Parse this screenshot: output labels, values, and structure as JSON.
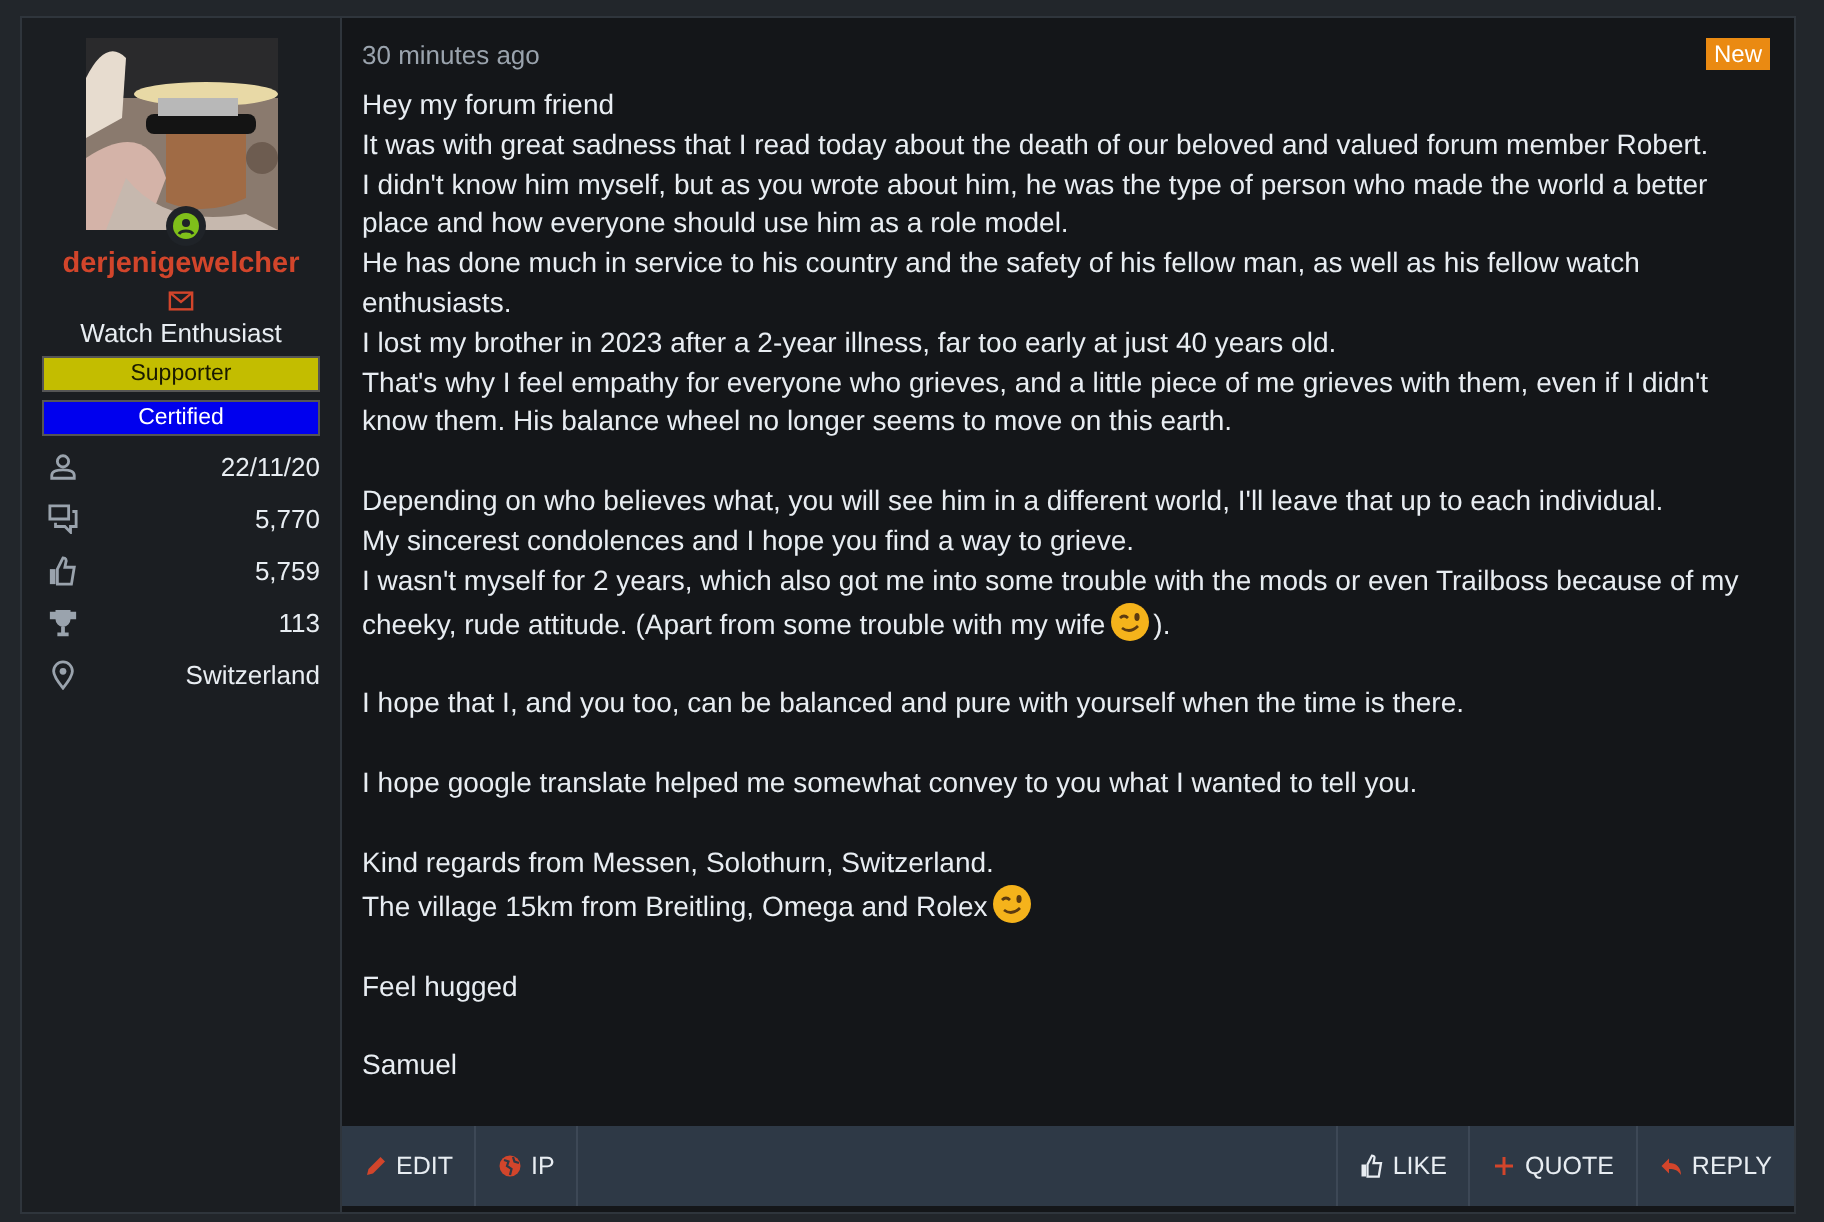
{
  "author": {
    "online": true,
    "username": "derjenigewelcher",
    "title": "Watch Enthusiast",
    "banners": [
      {
        "label": "Supporter",
        "color": "#c3bd00"
      },
      {
        "label": "Certified",
        "color": "#0000ee"
      }
    ],
    "stats": [
      {
        "kind": "joined",
        "value": "22/11/20"
      },
      {
        "kind": "messages",
        "value": "5,770"
      },
      {
        "kind": "reactions",
        "value": "5,759"
      },
      {
        "kind": "points",
        "value": "113"
      },
      {
        "kind": "location",
        "value": "Switzerland"
      }
    ]
  },
  "post": {
    "time": "30 minutes ago",
    "new_label": "New",
    "paragraphs": [
      [
        [
          {
            "kind": "text",
            "text": "Hey my forum friend"
          }
        ],
        [
          {
            "kind": "text",
            "text": "It was with great sadness that I read today about the death of our beloved and valued forum member Robert."
          }
        ],
        [
          {
            "kind": "text",
            "text": "I didn't know him myself, but as you wrote about him, he was the type of person who made the world a better place and how everyone should use him as a role model."
          }
        ],
        [
          {
            "kind": "text",
            "text": "He has done much in service to his country and the safety of his fellow man, as well as his fellow watch enthusiasts."
          }
        ],
        [
          {
            "kind": "text",
            "text": "I lost my brother in 2023 after a 2-year illness, far too early at just 40 years old."
          }
        ],
        [
          {
            "kind": "text",
            "text": "That's why I feel empathy for everyone who grieves, and a little piece of me grieves with them, even if I didn't know them. His balance wheel no longer seems to move on this earth."
          }
        ]
      ],
      [
        [
          {
            "kind": "text",
            "text": "Depending on who believes what, you will see him in a different world, I'll leave that up to each individual."
          }
        ],
        [
          {
            "kind": "text",
            "text": "My sincerest condolences and I hope you find a way to grieve."
          }
        ],
        [
          {
            "kind": "text",
            "text": "I wasn't myself for 2 years, which also got me into some trouble with the mods or even Trailboss because of my"
          }
        ],
        [
          {
            "kind": "text",
            "text": "cheeky, rude attitude. (Apart from some trouble with my wife"
          },
          {
            "kind": "emoji"
          },
          {
            "kind": "text",
            "text": ")."
          }
        ]
      ],
      [
        [
          {
            "kind": "text",
            "text": "I hope that I, and you too, can be balanced and pure with yourself when the time is there."
          }
        ]
      ],
      [
        [
          {
            "kind": "text",
            "text": "I hope google translate helped me somewhat convey to you what I wanted to tell you."
          }
        ]
      ],
      [
        [
          {
            "kind": "text",
            "text": "Kind regards from Messen, Solothurn, Switzerland."
          }
        ],
        [
          {
            "kind": "text",
            "text": "The village 15km from Breitling, Omega and Rolex"
          },
          {
            "kind": "emoji"
          }
        ]
      ],
      [
        [
          {
            "kind": "text",
            "text": "Feel hugged"
          }
        ]
      ],
      [
        [
          {
            "kind": "text",
            "text": "Samuel"
          }
        ]
      ]
    ],
    "actions_left": [
      {
        "kind": "edit",
        "label": "EDIT"
      },
      {
        "kind": "ip",
        "label": "IP"
      }
    ],
    "actions_right": [
      {
        "kind": "like",
        "label": "LIKE"
      },
      {
        "kind": "quote",
        "label": "QUOTE"
      },
      {
        "kind": "reply",
        "label": "REPLY"
      }
    ]
  }
}
